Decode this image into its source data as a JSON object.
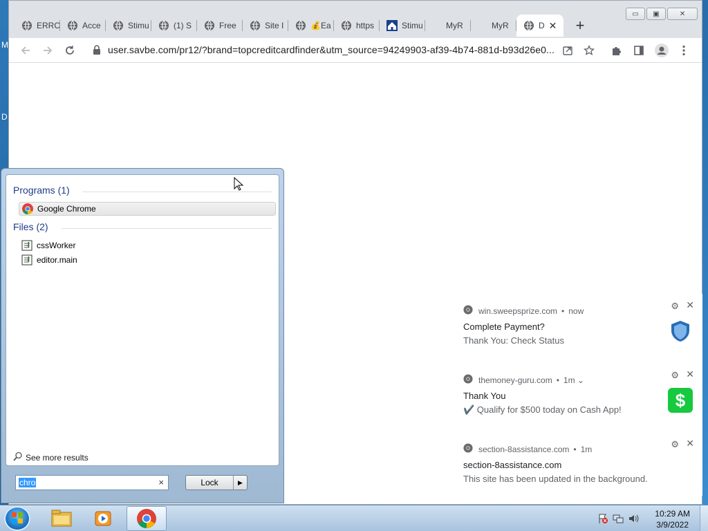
{
  "desktop": {
    "edge_labels": [
      "M",
      "D"
    ]
  },
  "browser": {
    "tabs": [
      {
        "title": "ERRO",
        "icon": "globe-icon"
      },
      {
        "title": "Acce",
        "icon": "globe-icon"
      },
      {
        "title": "Stimu",
        "icon": "globe-icon"
      },
      {
        "title": "(1) S",
        "icon": "globe-icon"
      },
      {
        "title": "Free",
        "icon": "globe-icon"
      },
      {
        "title": "Site I",
        "icon": "globe-icon"
      },
      {
        "title": "💰Ea",
        "icon": "globe-icon"
      },
      {
        "title": "https",
        "icon": "globe-icon"
      },
      {
        "title": "Stimu",
        "icon": "house-icon"
      },
      {
        "title": "MyR",
        "icon": "none"
      },
      {
        "title": "MyR",
        "icon": "none"
      },
      {
        "title": "D",
        "icon": "globe-icon",
        "active": true
      }
    ],
    "tab_close": "✕",
    "new_tab": "+",
    "url": "user.savbe.com/pr12/?brand=topcreditcardfinder&utm_source=94249903-af39-4b74-881d-b93d26e0...",
    "window_buttons": {
      "minimize": "▭",
      "maximize": "▣",
      "close": "✕"
    }
  },
  "notifications": [
    {
      "site": "win.sweepsprize.com",
      "time": "now",
      "title": "Complete Payment?",
      "body": "Thank You: Check Status",
      "image": "shield-icon"
    },
    {
      "site": "themoney-guru.com",
      "time": "1m ⌄",
      "title": "Thank You",
      "body": "✔️  Qualify for $500 today on Cash App!",
      "image": "dollar-icon",
      "image_text": "$"
    },
    {
      "site": "section-8assistance.com",
      "time": "1m",
      "title": "section-8assistance.com",
      "body": "This site has been updated in the background."
    }
  ],
  "notif_dot": "•",
  "start_menu": {
    "programs_header": "Programs (1)",
    "programs": [
      {
        "label": "Google Chrome",
        "icon": "chrome-icon"
      }
    ],
    "files_header": "Files (2)",
    "files": [
      {
        "label": "cssWorker",
        "icon": "script-file-icon"
      },
      {
        "label": "editor.main",
        "icon": "script-file-icon"
      }
    ],
    "see_more": "See more results",
    "search_value": "chro",
    "search_clear": "×",
    "lock_label": "Lock",
    "lock_arrow": "▶"
  },
  "taskbar": {
    "items": [
      "explorer-icon",
      "media-player-icon",
      "chrome-icon"
    ],
    "time": "10:29 AM",
    "date": "3/9/2022"
  },
  "colors": {
    "chrome_accent": "#1a73e8",
    "cash_app_green": "#16c93f",
    "start_header": "#1e3c87"
  }
}
